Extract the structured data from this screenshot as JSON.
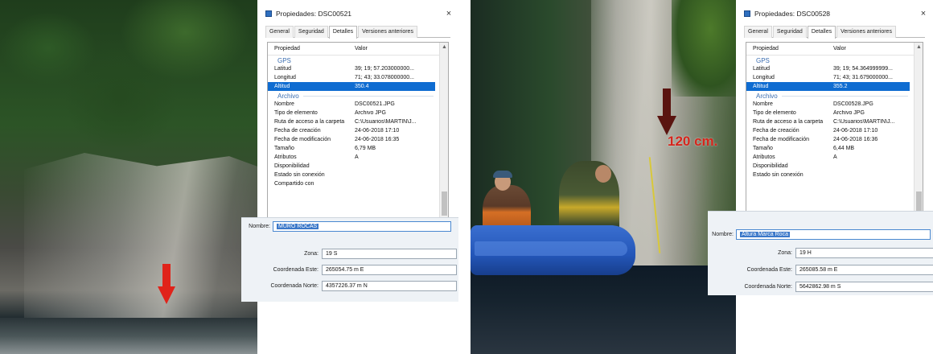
{
  "left": {
    "dialog": {
      "title": "Propiedades: DSC00521",
      "close": "×",
      "tabs": [
        "General",
        "Seguridad",
        "Detalles",
        "Versiones anteriores"
      ],
      "active_tab": "Detalles",
      "header": {
        "property": "Propiedad",
        "value": "Valor"
      },
      "sections": {
        "gps": "GPS",
        "archivo": "Archivo"
      },
      "gps_rows": [
        {
          "label": "Latitud",
          "value": "39; 19; 57.203000000..."
        },
        {
          "label": "Longitud",
          "value": "71; 43; 33.078000000..."
        },
        {
          "label": "Altitud",
          "value": "350.4"
        }
      ],
      "archivo_rows": [
        {
          "label": "Nombre",
          "value": "DSC00521.JPG"
        },
        {
          "label": "Tipo de elemento",
          "value": "Archivo JPG"
        },
        {
          "label": "Ruta de acceso a la carpeta",
          "value": "C:\\Usuarios\\MARTIN\\J..."
        },
        {
          "label": "Fecha de creación",
          "value": "24-06-2018 17:10"
        },
        {
          "label": "Fecha de modificación",
          "value": "24-06-2018 16:35"
        },
        {
          "label": "Tamaño",
          "value": "6,79 MB"
        },
        {
          "label": "Atributos",
          "value": "A"
        },
        {
          "label": "Disponibilidad",
          "value": ""
        },
        {
          "label": "Estado sin conexión",
          "value": ""
        },
        {
          "label": "Compartido con",
          "value": ""
        }
      ]
    },
    "geo": {
      "nombre_label": "Nombre:",
      "nombre_value": "MURO ROCAS",
      "zona_label": "Zona:",
      "zona_value": "19 S",
      "este_label": "Coordenada Este:",
      "este_value": "265054.75 m E",
      "norte_label": "Coordenada Norte:",
      "norte_value": "4357226.37 m N"
    }
  },
  "right": {
    "photo_label": "120 cm.",
    "dialog": {
      "title": "Propiedades: DSC00528",
      "close": "×",
      "tabs": [
        "General",
        "Seguridad",
        "Detalles",
        "Versiones anteriores"
      ],
      "active_tab": "Detalles",
      "header": {
        "property": "Propiedad",
        "value": "Valor"
      },
      "sections": {
        "gps": "GPS",
        "archivo": "Archivo"
      },
      "gps_rows": [
        {
          "label": "Latitud",
          "value": "39; 19; 54.364999999..."
        },
        {
          "label": "Longitud",
          "value": "71; 43; 31.679000000..."
        },
        {
          "label": "Altitud",
          "value": "355.2"
        }
      ],
      "archivo_rows": [
        {
          "label": "Nombre",
          "value": "DSC00528.JPG"
        },
        {
          "label": "Tipo de elemento",
          "value": "Archivo JPG"
        },
        {
          "label": "Ruta de acceso a la carpeta",
          "value": "C:\\Usuarios\\MARTIN\\J..."
        },
        {
          "label": "Fecha de creación",
          "value": "24-06-2018 17:10"
        },
        {
          "label": "Fecha de modificación",
          "value": "24-06-2018 16:36"
        },
        {
          "label": "Tamaño",
          "value": "6,44 MB"
        },
        {
          "label": "Atributos",
          "value": "A"
        },
        {
          "label": "Disponibilidad",
          "value": ""
        },
        {
          "label": "Estado sin conexión",
          "value": ""
        }
      ]
    },
    "geo": {
      "nombre_label": "Nombre:",
      "nombre_value": "Altura Marca Roca",
      "zona_label": "Zona:",
      "zona_value": "19 H",
      "este_label": "Coordenada Este:",
      "este_value": "265085.58 m E",
      "norte_label": "Coordenada Norte:",
      "norte_value": "5642862.98 m S"
    }
  },
  "colors": {
    "selection": "#0f6cd1",
    "arrow_red": "#e0231a",
    "arrow_dark": "#5a1410",
    "label_red": "#d6251c"
  }
}
